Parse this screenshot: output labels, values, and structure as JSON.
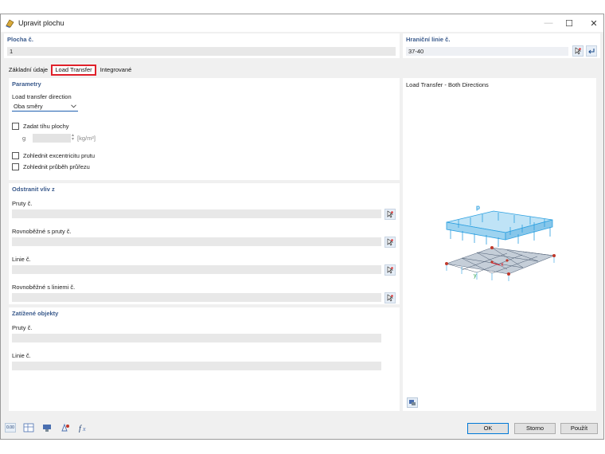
{
  "window": {
    "title": "Upravit plochu"
  },
  "header": {
    "surface_label": "Plocha č.",
    "surface_value": "1",
    "boundary_label": "Hraniční linie č.",
    "boundary_value": "37-40"
  },
  "tabs": [
    {
      "label": "Základní údaje"
    },
    {
      "label": "Load Transfer"
    },
    {
      "label": "Integrované"
    }
  ],
  "parameters": {
    "title": "Parametry",
    "direction_label": "Load transfer direction",
    "direction_value": "Oba směry",
    "weight_checkbox": "Zadat tíhu plochy",
    "g_label": "g",
    "g_unit": "[kg/m²]",
    "eccentricity_checkbox": "Zohlednit excentricitu prutu",
    "section_checkbox": "Zohlednit průběh průřezu"
  },
  "remove_influence": {
    "title": "Odstranit vliv z",
    "members_label": "Pruty č.",
    "parallel_members_label": "Rovnoběžné s pruty č.",
    "lines_label": "Linie č.",
    "parallel_lines_label": "Rovnoběžné s liniemi č."
  },
  "loaded_objects": {
    "title": "Zatížené objekty",
    "members_label": "Pruty č.",
    "lines_label": "Linie č."
  },
  "preview": {
    "title": "Load Transfer - Both Directions",
    "load_symbol": "p",
    "axis_y": "y",
    "axis_x": "x"
  },
  "footer": {
    "ok": "OK",
    "cancel": "Storno",
    "apply": "Použít",
    "units_icon_text": "0.00"
  },
  "colors": {
    "accent_red": "#e0202a",
    "section_blue": "#3a5a8c",
    "load_blue": "#2a9fe0"
  }
}
